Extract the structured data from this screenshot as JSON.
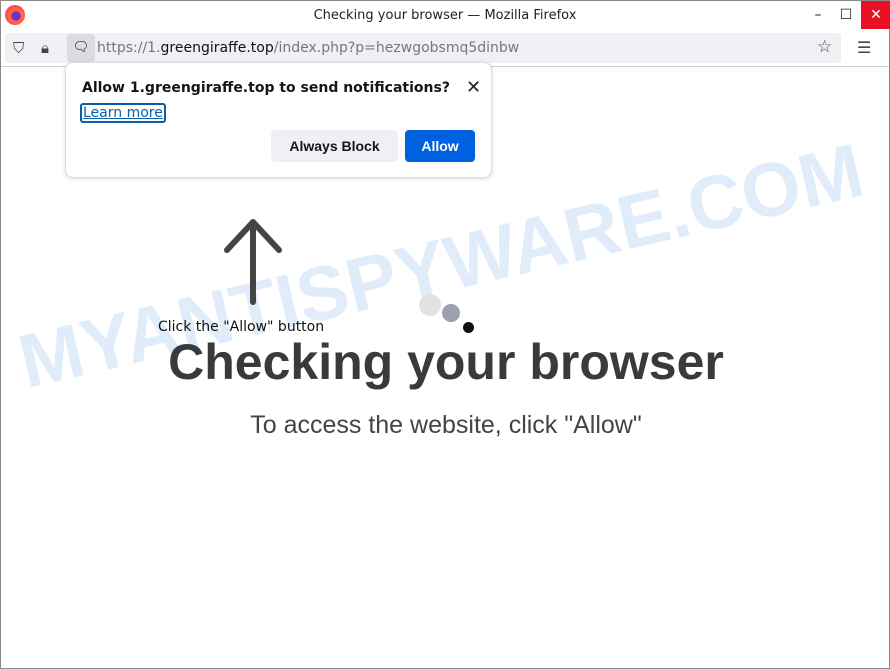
{
  "window": {
    "title": "Checking your browser — Mozilla Firefox",
    "minimize": "–",
    "maximize": "☐",
    "close": "✕"
  },
  "urlbar": {
    "scheme": "https://1.",
    "domain": "greengiraffe.top",
    "path": "/index.php?p=hezwgobsmq5dinbw"
  },
  "popup": {
    "question": "Allow 1.greengiraffe.top to send notifications?",
    "learn_more": "Learn more",
    "block_label": "Always Block",
    "allow_label": "Allow"
  },
  "page": {
    "hint": "Click the \"Allow\" button",
    "heading": "Checking your browser",
    "subtext": "To access the website, click \"Allow\""
  },
  "watermark": "MYANTISPYWARE.COM",
  "colors": {
    "allow": "#0061e0",
    "close": "#e81123"
  }
}
